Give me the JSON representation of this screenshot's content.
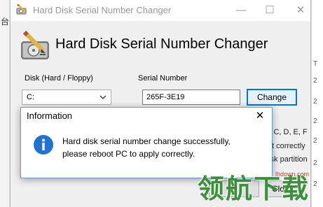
{
  "background": {
    "left_char": "台",
    "right_ticks": [
      "T",
      "2",
      "2",
      "2",
      "2",
      "2",
      "2"
    ]
  },
  "window": {
    "title": "Hard Disk Serial Number Changer",
    "controls": {
      "minimize": "—",
      "maximize": "☐",
      "close": "✕"
    }
  },
  "header": {
    "title": "Hard Disk Serial Number Changer",
    "icon": "hard-disk-pencil-icon"
  },
  "disk": {
    "label": "Disk (Hard / Floppy)",
    "selected": "C:"
  },
  "serial": {
    "label": "Serial Number",
    "value": "265F-3E19",
    "change_label": "Change"
  },
  "partial_text": {
    "line1": "B, C, D, E, F",
    "line2": "y it correctly",
    "line3": "disk partition"
  },
  "buttons": {
    "ok_label": "O",
    "close_label": "Clo"
  },
  "dialog": {
    "title": "Information",
    "close": "✕",
    "icon": "info-icon",
    "message_line1": "Hard disk serial number change successfully,",
    "message_line2": "please reboot PC to apply correctly."
  },
  "watermark": {
    "site": "lhdown.com",
    "brand": "领航下载"
  },
  "colors": {
    "accent": "#0078d7",
    "info_blue": "#1e73d2",
    "watermark_green": "#2e8b2e",
    "watermark_red": "#d63c2b"
  }
}
